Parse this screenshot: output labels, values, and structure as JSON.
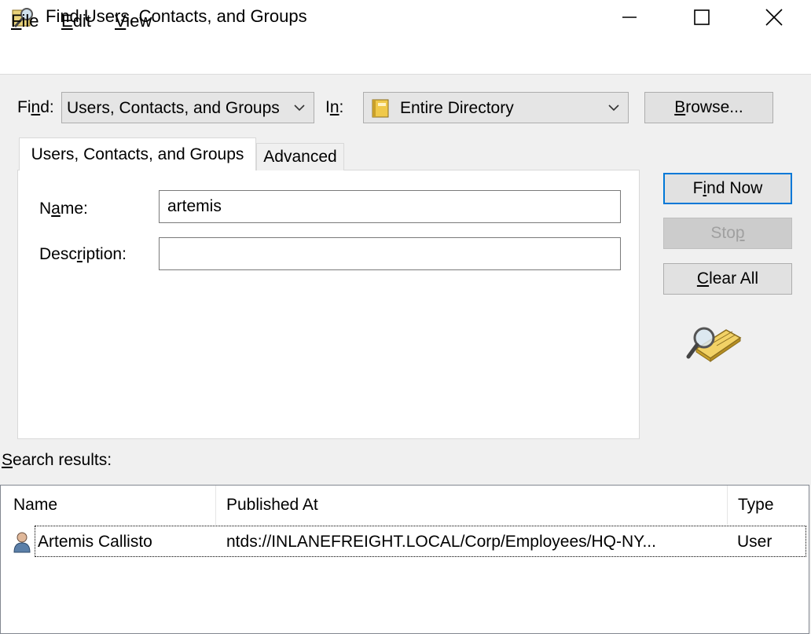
{
  "window": {
    "title": "Find Users, Contacts, and Groups",
    "controls": [
      "minimize-icon",
      "maximize-icon",
      "close-icon"
    ]
  },
  "menu": {
    "file": {
      "mnemonic": "F",
      "rest": "ile"
    },
    "edit": {
      "mnemonic": "E",
      "rest": "dit"
    },
    "view": {
      "mnemonic": "V",
      "rest": "iew"
    }
  },
  "find_row": {
    "find_label_pre": "Fi",
    "find_label_mn": "n",
    "find_label_post": "d:",
    "find_value": "Users, Contacts, and Groups",
    "in_label_pre": "I",
    "in_label_mn": "n",
    "in_label_post": ":",
    "in_value": "Entire Directory",
    "browse_mn": "B",
    "browse_rest": "rowse..."
  },
  "tabs": {
    "basic": "Users, Contacts, and Groups",
    "advanced": "Advanced"
  },
  "form": {
    "name_label_pre": "N",
    "name_label_mn": "a",
    "name_label_post": "me:",
    "name_value": "artemis",
    "desc_label_pre": "Desc",
    "desc_label_mn": "r",
    "desc_label_post": "iption:",
    "desc_value": ""
  },
  "actions": {
    "find_now_mn": "i",
    "find_now_pre": "F",
    "find_now_post": "nd Now",
    "stop_pre": "Sto",
    "stop_mn": "p",
    "clear_mn": "C",
    "clear_rest": "lear All"
  },
  "results": {
    "label_mn": "S",
    "label_rest": "earch results:",
    "columns": [
      "Name",
      "Published At",
      "Type"
    ],
    "rows": [
      {
        "name": "Artemis Callisto",
        "published_at": "ntds://INLANEFREIGHT.LOCAL/Corp/Employees/HQ-NY...",
        "type": "User"
      }
    ]
  },
  "colors": {
    "focus_border": "#0078d7",
    "window_bg": "#f0f0f0"
  }
}
